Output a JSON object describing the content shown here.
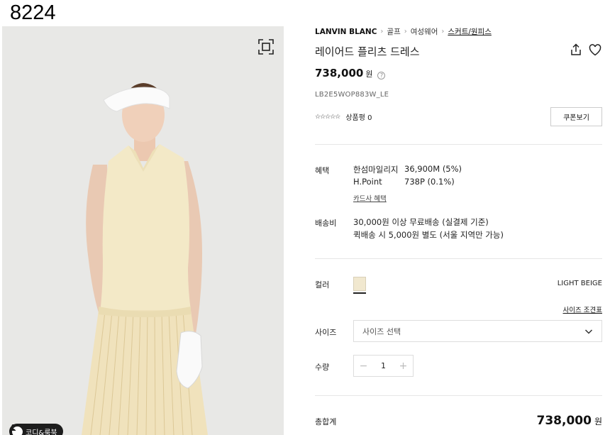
{
  "overlay_id": "8224",
  "coordi_label": "코디&룩북",
  "breadcrumb": {
    "brand": "LANVIN BLANC",
    "items": [
      "골프",
      "여성웨어",
      "스커트/원피스"
    ]
  },
  "product": {
    "title": "레이어드 플리츠 드레스",
    "price": "738,000",
    "currency": "원",
    "code": "LB2E5WOP883W_LE",
    "stars": "☆☆☆☆☆",
    "review_label": "상품평 0"
  },
  "coupon_label": "쿠폰보기",
  "benefit": {
    "label": "혜택",
    "items": [
      {
        "name": "한섬마일리지",
        "value": "36,900M (5%)"
      },
      {
        "name": "H.Point",
        "value": "738P (0.1%)"
      }
    ],
    "card_link": "카드사 혜택"
  },
  "shipping": {
    "label": "배송비",
    "lines": [
      "30,000원 이상 무료배송 (실결제 기준)",
      "퀵배송 시 5,000원 별도 (서울 지역만 가능)"
    ]
  },
  "color": {
    "label": "컬러",
    "name": "LIGHT BEIGE",
    "swatch": "#f1e8cf"
  },
  "size": {
    "label": "사이즈",
    "guide": "사이즈 조견표",
    "placeholder": "사이즈 선택"
  },
  "quantity": {
    "label": "수량",
    "minus": "−",
    "value": "1",
    "plus": "+"
  },
  "total": {
    "label": "총합계",
    "value": "738,000",
    "currency": "원"
  }
}
